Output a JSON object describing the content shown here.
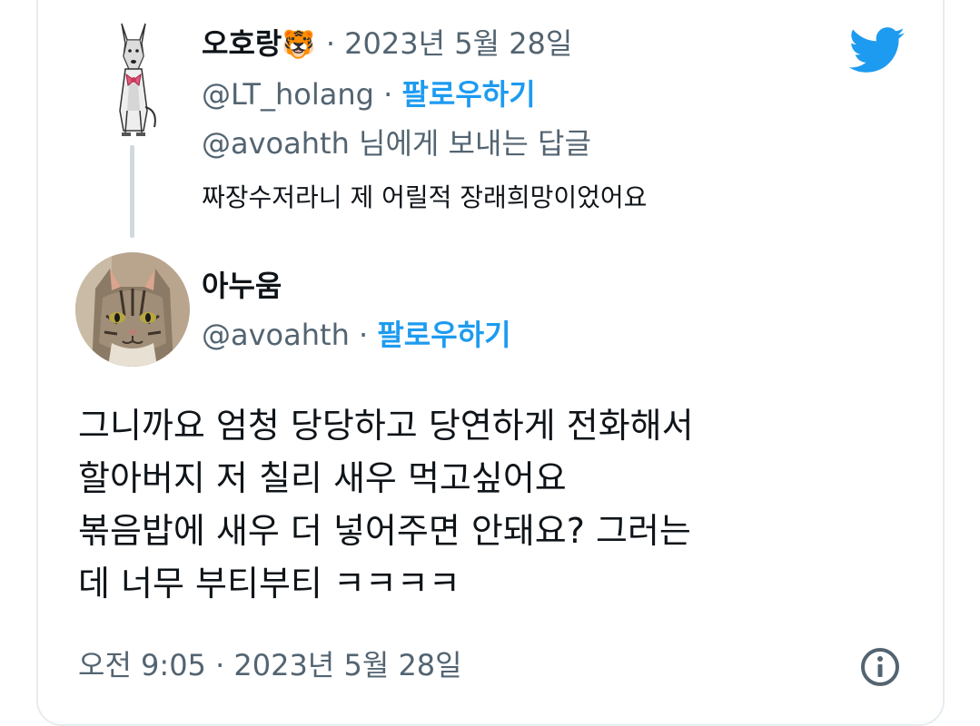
{
  "reply_tweet": {
    "display_name": "오호랑",
    "name_emoji": "🐯",
    "date": "2023년 5월 28일",
    "handle": "@LT_holang",
    "follow_label": "팔로우하기",
    "replying_to": "@avoahth 님에게 보내는 답글",
    "text": "짜장수저라니 제 어릴적 장래희망이었어요"
  },
  "main_tweet": {
    "display_name": "아누움",
    "handle": "@avoahth",
    "follow_label": "팔로우하기",
    "lines": [
      "그니까요 엄청 당당하고 당연하게 전화해서",
      "할아버지 저 칠리 새우 먹고싶어요",
      "볶음밥에 새우 더 넣어주면 안돼요? 그러는",
      "데 너무 부티부티 ㅋㅋㅋㅋ"
    ],
    "timestamp": "오전 9:05 · 2023년 5월 28일"
  },
  "separator": "·",
  "icons": {
    "brand": "twitter-bird-icon",
    "info": "info-icon"
  },
  "colors": {
    "link_blue": "#1d9bf0",
    "muted_text": "#536471",
    "thread_line": "#cfd9de"
  }
}
